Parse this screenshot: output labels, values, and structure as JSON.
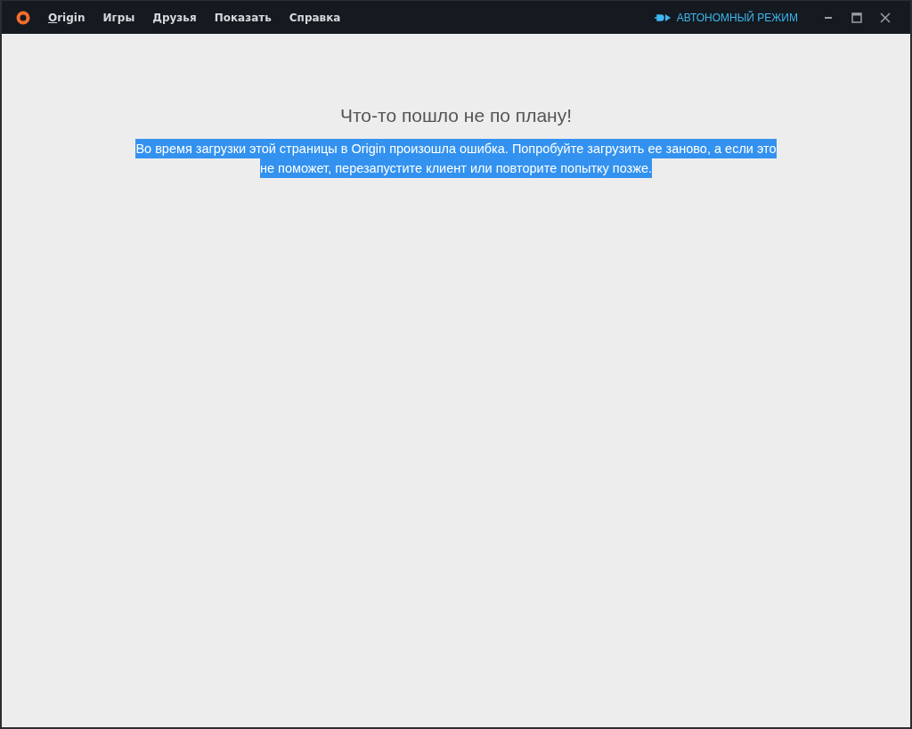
{
  "menu": [
    {
      "label": "Origin"
    },
    {
      "label": "Игры"
    },
    {
      "label": "Друзья"
    },
    {
      "label": "Показать"
    },
    {
      "label": "Справка"
    }
  ],
  "offline_mode": {
    "label": "АВТОНОМНЫЙ РЕЖИМ"
  },
  "error": {
    "title": "Что-то пошло не по плану!",
    "message_lines": [
      "Во время загрузки этой страницы в Origin произошла ошибка. Попробуйте загрузить ее заново, а если это",
      "не поможет, перезапустите клиент или повторите попытку позже."
    ],
    "selected": true
  }
}
